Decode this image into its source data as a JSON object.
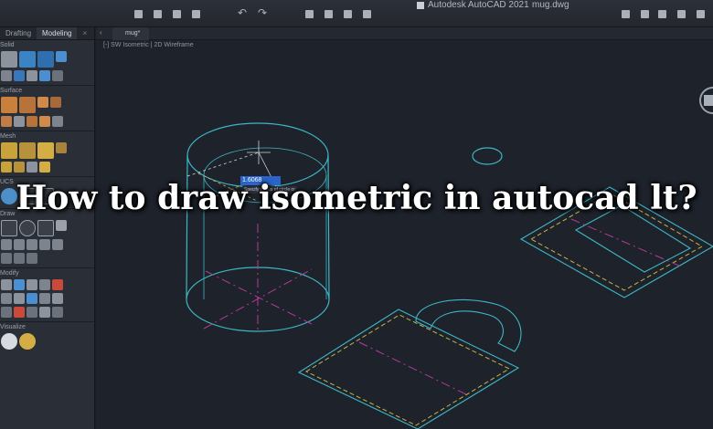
{
  "app": {
    "title": "Autodesk AutoCAD 2021",
    "document_name": "mug.dwg"
  },
  "palette": {
    "tabs": [
      {
        "label": "Drafting",
        "active": false
      },
      {
        "label": "Modeling",
        "active": true
      }
    ],
    "close_glyph": "×",
    "sections": [
      {
        "title": "Solid"
      },
      {
        "title": "Surface"
      },
      {
        "title": "Mesh"
      },
      {
        "title": "UCS"
      },
      {
        "title": "Draw"
      },
      {
        "title": "Modify"
      },
      {
        "title": "Visualize"
      }
    ]
  },
  "drawing": {
    "tab_label": "mug*",
    "viewport_label": "[-] SW Isometric | 2D Wireframe",
    "dimension_value": "1.6068",
    "tooltip_text": "Specify radius of circle or"
  },
  "overlay": {
    "heading": "How to draw isometric in autocad lt?"
  },
  "colors": {
    "wire_cyan": "#3fb6c4",
    "dashed_yellow": "#c9b24a",
    "center_magenta": "#b53a9a"
  }
}
